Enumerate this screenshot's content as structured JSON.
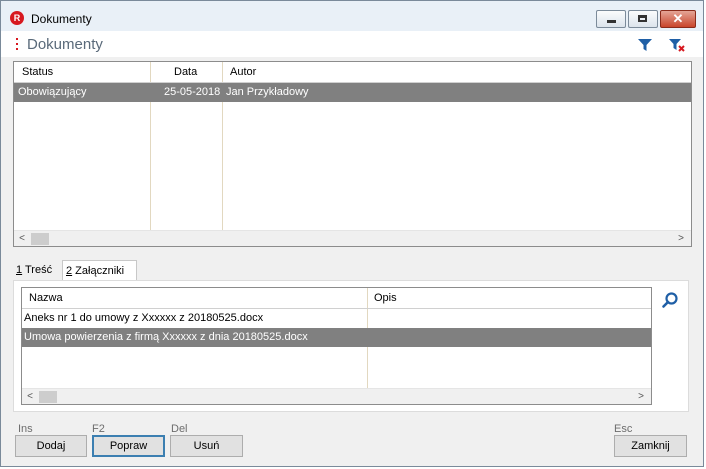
{
  "window": {
    "app_badge": "R",
    "title": "Dokumenty",
    "close_glyph": "✕"
  },
  "header": {
    "title": "Dokumenty"
  },
  "documents": {
    "columns": [
      "Status",
      "Data",
      "Autor"
    ],
    "rows": [
      {
        "status": "Obowiązujący",
        "data": "25-05-2018",
        "autor": "Jan Przykładowy",
        "selected": true
      }
    ]
  },
  "tabs": [
    {
      "key": "1",
      "label": " Treść"
    },
    {
      "key": "2",
      "label": " Załączniki",
      "active": true
    }
  ],
  "attachments": {
    "columns": [
      "Nazwa",
      "Opis"
    ],
    "rows": [
      {
        "nazwa": "Aneks nr 1 do umowy z Xxxxxx z 20180525.docx",
        "opis": ""
      },
      {
        "nazwa": "Umowa powierzenia z firmą Xxxxxx z dnia 20180525.docx",
        "opis": "",
        "selected": true
      }
    ]
  },
  "scroll": {
    "left_arrow": "<",
    "right_arrow": ">"
  },
  "footer": {
    "buttons": [
      {
        "shortcut": "Ins",
        "label": "Dodaj"
      },
      {
        "shortcut": "F2",
        "label": "Popraw"
      },
      {
        "shortcut": "Del",
        "label": "Usuń"
      },
      {
        "shortcut": "Esc",
        "label": "Zamknij"
      }
    ]
  },
  "icons": {
    "app": "app-logo-icon",
    "filter": "filter-icon",
    "filter_clear": "filter-clear-icon",
    "search": "search-icon"
  },
  "colors": {
    "brand_red": "#d71920",
    "selection": "#808080",
    "accent_blue": "#1f5fa6"
  }
}
